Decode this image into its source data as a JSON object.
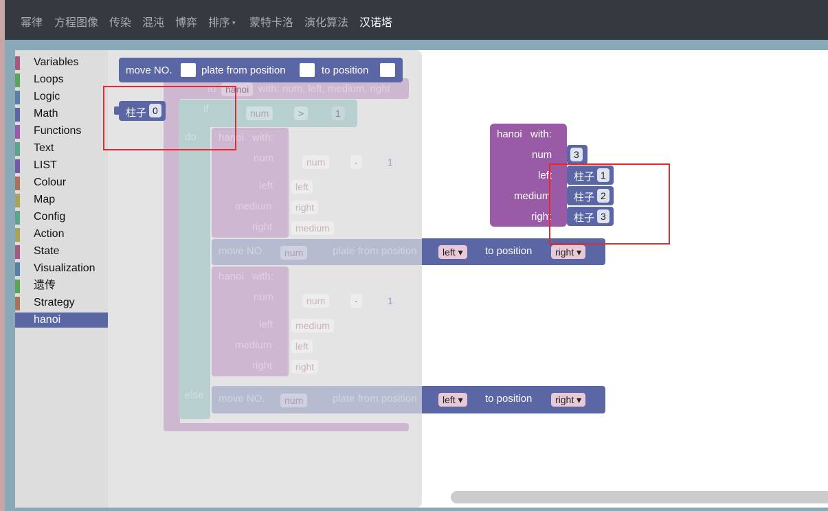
{
  "nav": {
    "items": [
      "幂律",
      "方程图像",
      "传染",
      "混沌",
      "博弈",
      "排序",
      "蒙特卡洛",
      "演化算法",
      "汉诺塔"
    ],
    "caret": "▾",
    "active_index": 8
  },
  "toolbox": {
    "categories": [
      {
        "label": "Variables",
        "color": "#a55b80"
      },
      {
        "label": "Loops",
        "color": "#5ba55b"
      },
      {
        "label": "Logic",
        "color": "#5b80a5"
      },
      {
        "label": "Math",
        "color": "#5b67a5"
      },
      {
        "label": "Functions",
        "color": "#995ba5"
      },
      {
        "label": "Text",
        "color": "#5ba58c"
      },
      {
        "label": "LIST",
        "color": "#745ba5"
      },
      {
        "label": "Colour",
        "color": "#a5745b"
      },
      {
        "label": "Map",
        "color": "#a5a55b"
      },
      {
        "label": "Config",
        "color": "#5ba58c"
      },
      {
        "label": "Action",
        "color": "#a5a55b"
      },
      {
        "label": "State",
        "color": "#a55b80"
      },
      {
        "label": "Visualization",
        "color": "#5b80a5"
      },
      {
        "label": "遗传",
        "color": "#5ba55b"
      },
      {
        "label": "Strategy",
        "color": "#a5745b"
      },
      {
        "label": "hanoi",
        "color": "#5b67a5"
      }
    ],
    "selected_index": 15
  },
  "flyout": {
    "move_block": {
      "move_label": "move NO.",
      "from_label": "plate from position",
      "to_label": "to position"
    },
    "pillar_block": {
      "label": "柱子",
      "value": "0"
    }
  },
  "ghost_def": {
    "to_label": "to",
    "name": "hanoi",
    "params": "with: num, left, medium, right",
    "if_label": "if",
    "do_label": "do",
    "else_label": "else",
    "cond": {
      "var": "num",
      "op": ">",
      "value": "1"
    },
    "call1": {
      "name": "hanoi",
      "with": "with:",
      "num_label": "num",
      "num_var": "num",
      "num_op": "-",
      "num_value": "1",
      "left_label": "left",
      "left_var": "left",
      "medium_label": "medium",
      "medium_var": "right",
      "right_label": "right",
      "right_var": "medium"
    },
    "move1": {
      "move_label": "move NO.",
      "num": "num",
      "from_label": "plate from position",
      "left": "left",
      "to_label": "to position",
      "right": "right"
    },
    "call2": {
      "name": "hanoi",
      "with": "with:",
      "num_label": "num",
      "num_var": "num",
      "num_op": "-",
      "num_value": "1",
      "left_label": "left",
      "left_var": "medium",
      "medium_label": "medium",
      "medium_var": "left",
      "right_label": "right",
      "right_var": "right"
    },
    "move2": {
      "move_label": "move NO.",
      "num": "num",
      "from_label": "plate from position",
      "left": "left",
      "to_label": "to position",
      "right": "right"
    }
  },
  "call_block": {
    "name": "hanoi",
    "with": "with:",
    "num_label": "num",
    "num_value": "3",
    "left_label": "left",
    "left_pillar": "柱子",
    "left_value": "1",
    "medium_label": "medium",
    "medium_pillar": "柱子",
    "medium_value": "2",
    "right_label": "right",
    "right_pillar": "柱子",
    "right_value": "3"
  },
  "colors": {
    "navbar": "#343a40",
    "procedure": "#995ba5",
    "action": "#5b67a5",
    "variable": "#a55b80",
    "highlight": "#e8272c"
  }
}
